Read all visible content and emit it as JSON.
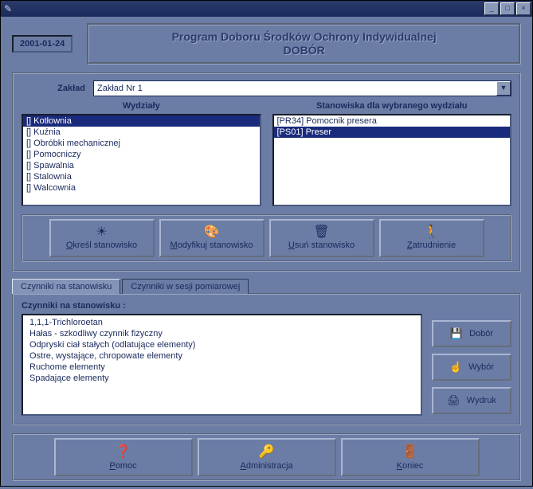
{
  "date": "2001-01-24",
  "banner": {
    "line1": "Program Doboru Środków Ochrony Indywidualnej",
    "line2": "DOBÓR"
  },
  "zaklad": {
    "label": "Zakład",
    "selected": "Zakład Nr 1"
  },
  "wydzialy": {
    "header": "Wydziały",
    "items": [
      "[] Kotłownia",
      "[] Kuźnia",
      "[] Obróbki mechanicznej",
      "[] Pomocniczy",
      "[] Spawalnia",
      "[] Stalownia",
      "[] Walcownia"
    ],
    "selected_index": 0
  },
  "stanowiska": {
    "header": "Stanowiska dla wybranego wydziału",
    "items": [
      "[PR34] Pomocnik presera",
      "[PS01] Preser"
    ],
    "selected_index": 1
  },
  "action_buttons": {
    "okresl": "Określ stanowisko",
    "modyfikuj": "Modyfikuj stanowisko",
    "usun": "Usuń stanowisko",
    "zatrudnienie": "Zatrudnienie"
  },
  "tabs": {
    "tab1": "Czynniki na stanowisku",
    "tab2": "Czynniki w sesji pomiarowej"
  },
  "czynniki": {
    "title": "Czynniki na stanowisku :",
    "items": [
      "1,1,1-Trichloroetan",
      "Hałas - szkodliwy czynnik fizyczny",
      "Odpryski ciał stałych (odlatujące elementy)",
      "Ostre, wystające, chropowate elementy",
      "Ruchome elementy",
      "Spadające elementy"
    ]
  },
  "side_buttons": {
    "dobor": "Dobór",
    "wybor": "Wybór",
    "wydruk": "Wydruk"
  },
  "bottom_buttons": {
    "pomoc": "Pomoc",
    "admin": "Administracja",
    "koniec": "Koniec"
  }
}
